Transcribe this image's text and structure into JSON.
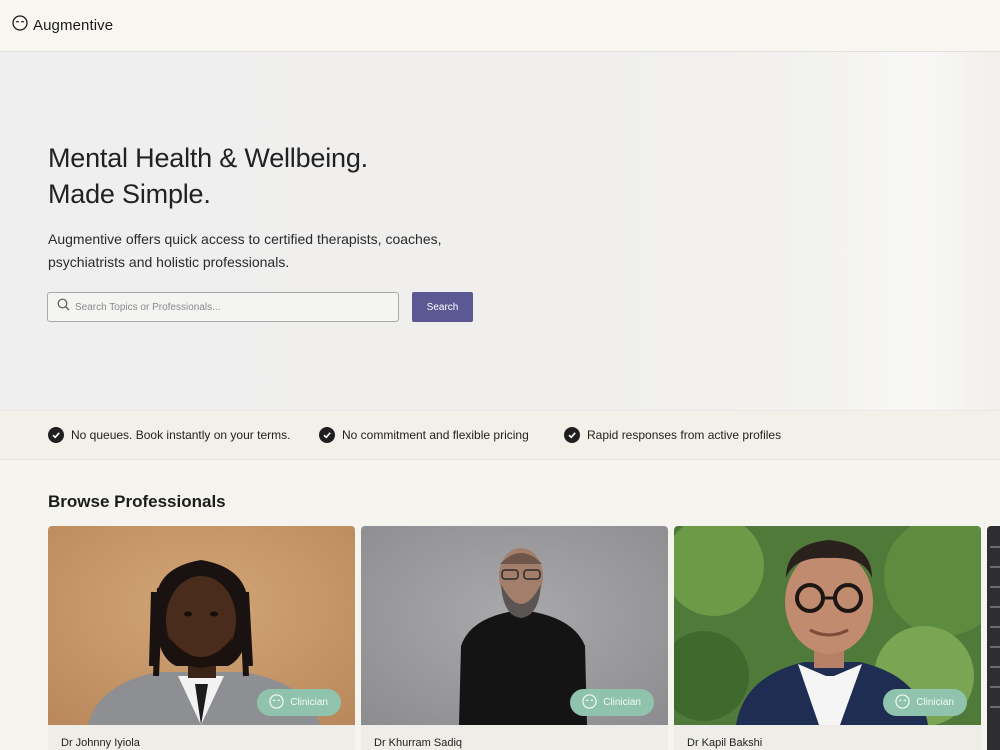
{
  "brand": {
    "name": "Augmentive"
  },
  "hero": {
    "title_line1": "Mental Health & Wellbeing.",
    "title_line2": "Made Simple.",
    "description": "Augmentive offers quick access to certified therapists, coaches, psychiatrists and holistic professionals.",
    "search": {
      "placeholder": "Search Topics or Professionals...",
      "value": "",
      "button_label": "Search"
    }
  },
  "features": [
    {
      "label": "No queues. Book instantly on your terms."
    },
    {
      "label": "No commitment and flexible pricing"
    },
    {
      "label": "Rapid responses from active profiles"
    }
  ],
  "browse": {
    "title": "Browse Professionals",
    "cards": [
      {
        "name": "Dr Johnny Iyiola",
        "badge": "Clinician"
      },
      {
        "name": "Dr Khurram Sadiq",
        "badge": "Clinician"
      },
      {
        "name": "Dr Kapil Bakshi",
        "badge": "Clinician"
      }
    ]
  },
  "icons": {
    "logo": "smile-face-icon",
    "search": "search-icon",
    "check": "check-circle-icon",
    "badge": "smile-face-icon"
  },
  "colors": {
    "accent": "#5b5894",
    "badge": "#8fc3ad",
    "background": "#f6f4ef"
  }
}
